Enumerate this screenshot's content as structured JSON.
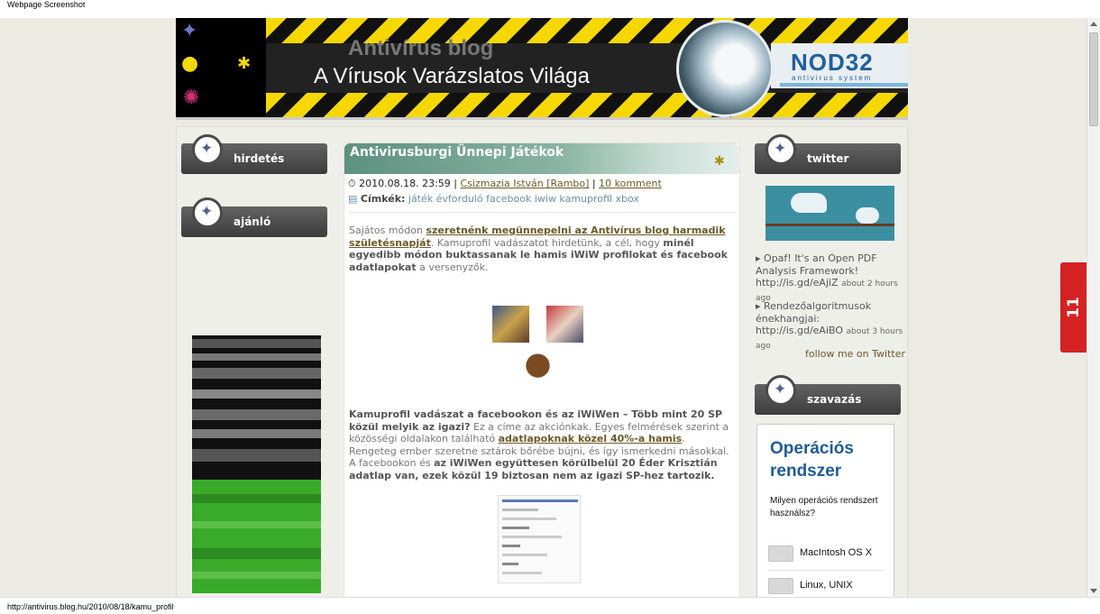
{
  "window": {
    "title": "Webpage Screenshot",
    "status_url": "http://antivirus.blog.hu/2010/08/18/kamu_profil"
  },
  "banner": {
    "title": "Antivírus blog",
    "subtitle": "A Vírusok Varázslatos Világa",
    "brand": "NOD32",
    "brand_sub": "antivirus system"
  },
  "left_sidebar": {
    "widgets": [
      {
        "label": "hirdetés"
      },
      {
        "label": "ajánló"
      }
    ]
  },
  "post": {
    "title": "Antivirusburgi Ünnepi Játékok",
    "date": "2010.08.18. 23:59",
    "author": "Csizmazia István [Rambo]",
    "comments": "10 komment",
    "tags_label": "Címkék:",
    "tags": "játék évforduló facebook iwiw kamuprofil xbox",
    "p1_intro": "Sajátos módon ",
    "p1_link": "szeretnénk megünnepelni az Antivírus blog harmadik születésnapját",
    "p1_mid": ". Kamuprofil vadászatot hirdetünk, a cél, hogy ",
    "p1_bold": "minél egyedibb módon buktassanak le hamis iWiW profilokat és facebook adatlapokat",
    "p1_end": " a versenyzők.",
    "p2_bold": "Kamuprofil vadászat a facebookon és az iWiWen – Több mint 20 SP közül melyik az igazi?",
    "p2_a": " Ez a címe az akciónkak. Egyes felmérések szerint a közösségi oldalakon található ",
    "p2_link": "adatlapoknak közel 40%-a hamis",
    "p2_b": ". Rengeteg ember szeretne sztárok bőrébe bújni, és így ismerkedni másokkal. A facebookon és ",
    "p2_bold2": "az iWiWen együttesen körülbelül 20 Éder Krisztián adatlap van, ezek közül 19 biztosan nem az igazi SP-hez tartozik."
  },
  "right_sidebar": {
    "twitter_label": "twitter",
    "tweets": [
      {
        "text": "Opaf! It's an Open PDF Analysis Framework! http://is.gd/eAjiZ",
        "time": "about 2 hours ago"
      },
      {
        "text": "Rendezőalgoritmusok énekhangjai: http://is.gd/eAiBO",
        "time": "about 3 hours ago"
      }
    ],
    "follow": "follow me on Twitter",
    "poll_label": "szavazás",
    "poll": {
      "title": "Operációs rendszer",
      "question": "Milyen operációs rendszert használsz?",
      "options": [
        "MacIntosh OS X",
        "Linux, UNIX"
      ]
    }
  },
  "side_tab": {
    "count": "11"
  },
  "colors": {
    "accent": "#6b5a28",
    "stripe": "#f6d800",
    "poll_title": "#1f5c96",
    "side_tab": "#d42222"
  }
}
